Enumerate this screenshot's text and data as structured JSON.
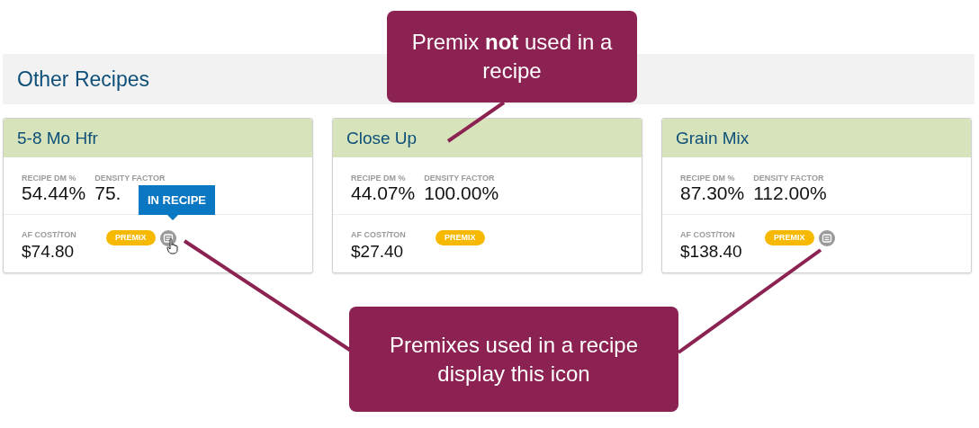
{
  "section": {
    "title": "Other Recipes"
  },
  "cards": [
    {
      "name": "5-8 Mo Hfr",
      "stats": [
        {
          "label": "RECIPE DM %",
          "value": "54.44%"
        },
        {
          "label": "DENSITY FACTOR",
          "value": "75."
        }
      ],
      "cost_label": "AF COST/TON",
      "cost": "$74.80",
      "badge": "PREMIX",
      "in_recipe": true,
      "tooltip": "IN RECIPE",
      "hover": true
    },
    {
      "name": "Close Up",
      "stats": [
        {
          "label": "RECIPE DM %",
          "value": "44.07%"
        },
        {
          "label": "DENSITY FACTOR",
          "value": "100.00%"
        }
      ],
      "cost_label": "AF COST/TON",
      "cost": "$27.40",
      "badge": "PREMIX",
      "in_recipe": false,
      "hover": false
    },
    {
      "name": "Grain Mix",
      "stats": [
        {
          "label": "RECIPE DM %",
          "value": "87.30%"
        },
        {
          "label": "DENSITY FACTOR",
          "value": "112.00%"
        }
      ],
      "cost_label": "AF COST/TON",
      "cost": "$138.40",
      "badge": "PREMIX",
      "in_recipe": true,
      "hover": false
    }
  ],
  "callouts": [
    {
      "text": "Premix **not** used in a recipe",
      "kind": "top"
    },
    {
      "text": "Premixes used in a recipe display this icon",
      "kind": "bottom"
    }
  ]
}
